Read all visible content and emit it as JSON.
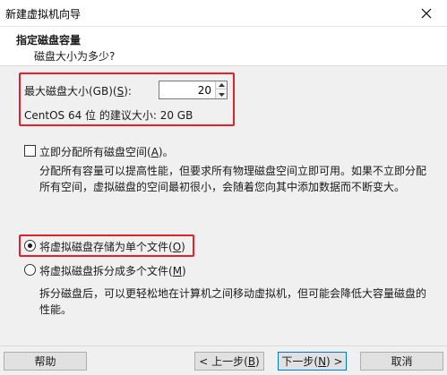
{
  "window": {
    "title": "新建虚拟机向导"
  },
  "header": {
    "title": "指定磁盘容量",
    "subtitle": "磁盘大小为多少?"
  },
  "disk_size": {
    "label_prefix": "最大磁盘大小(GB)(",
    "label_key": "S",
    "label_suffix": "):",
    "value": "20",
    "recommendation": "CentOS 64 位 的建议大小: 20 GB"
  },
  "allocate_now": {
    "label_prefix": "立即分配所有磁盘空间(",
    "label_key": "A",
    "label_suffix": ")。",
    "checked": false,
    "description": "分配所有容量可以提高性能，但要求所有物理磁盘空间立即可用。如果不立即分配所有空间，虚拟磁盘的空间最初很小，会随着您向其中添加数据而不断变大。"
  },
  "storage": {
    "single_file": {
      "label_prefix": "将虚拟磁盘存储为单个文件(",
      "label_key": "O",
      "label_suffix": ")",
      "selected": true
    },
    "multiple_files": {
      "label_prefix": "将虚拟磁盘拆分成多个文件(",
      "label_key": "M",
      "label_suffix": ")",
      "selected": false,
      "description": "拆分磁盘后，可以更轻松地在计算机之间移动虚拟机，但可能会降低大容量磁盘的性能。"
    }
  },
  "footer": {
    "help": "帮助",
    "prev_prefix": "< 上一步(",
    "prev_key": "B",
    "prev_suffix": ")",
    "next_prefix": "下一步(",
    "next_key": "N",
    "next_suffix": ") >",
    "cancel": "取消"
  },
  "colors": {
    "highlight_box": "#e3212b",
    "focus_border": "#0078d7",
    "panel_bg": "#f0f0f0"
  }
}
